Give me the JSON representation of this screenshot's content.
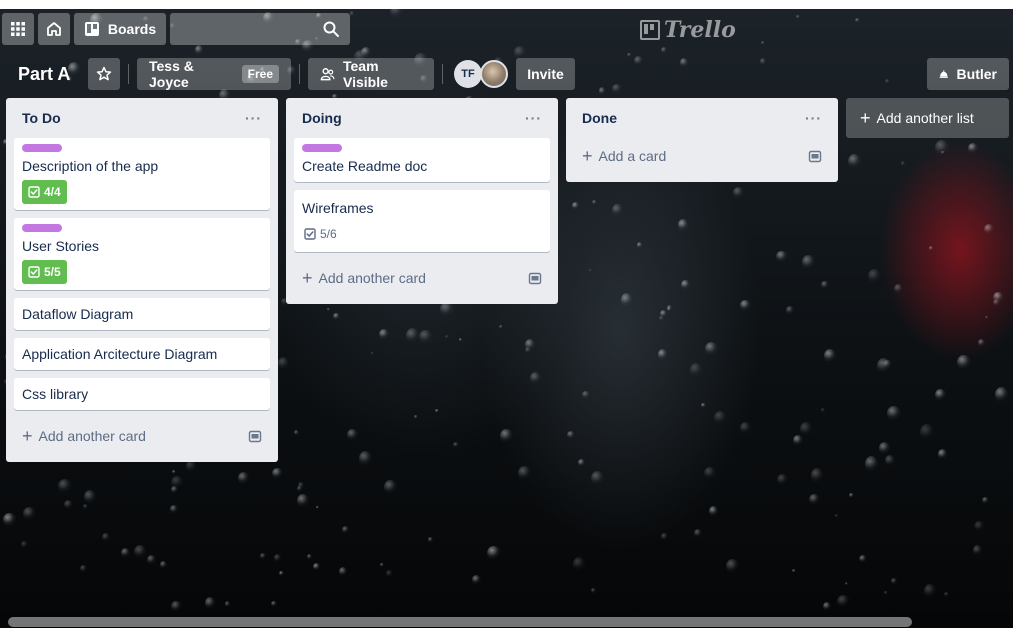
{
  "nav": {
    "boards_label": "Boards",
    "search_placeholder": "",
    "logo_text": "Trello"
  },
  "board": {
    "title": "Part A",
    "team_label": "Tess & Joyce",
    "team_badge": "Free",
    "visibility_label": "Team Visible",
    "member_initials": "TF",
    "invite_label": "Invite",
    "butler_label": "Butler"
  },
  "lists": [
    {
      "title": "To Do",
      "menu": "···",
      "cards": [
        {
          "title": "Description of the app",
          "label_color": "#c377e0",
          "badge": "4/4",
          "badge_complete": true
        },
        {
          "title": "User Stories",
          "label_color": "#c377e0",
          "badge": "5/5",
          "badge_complete": true
        },
        {
          "title": "Dataflow Diagram"
        },
        {
          "title": "Application Arcitecture Diagram"
        },
        {
          "title": "Css library"
        }
      ],
      "add_label": "Add another card"
    },
    {
      "title": "Doing",
      "menu": "···",
      "cards": [
        {
          "title": "Create Readme doc",
          "label_color": "#c377e0"
        },
        {
          "title": "Wireframes",
          "badge": "5/6",
          "badge_complete": false
        }
      ],
      "add_label": "Add another card"
    },
    {
      "title": "Done",
      "menu": "···",
      "cards": [],
      "add_label": "Add a card"
    }
  ],
  "add_list_label": "Add another list",
  "colors": {
    "label_purple": "#c377e0",
    "checklist_green": "#61bd4f",
    "list_bg": "#ebecf0"
  }
}
